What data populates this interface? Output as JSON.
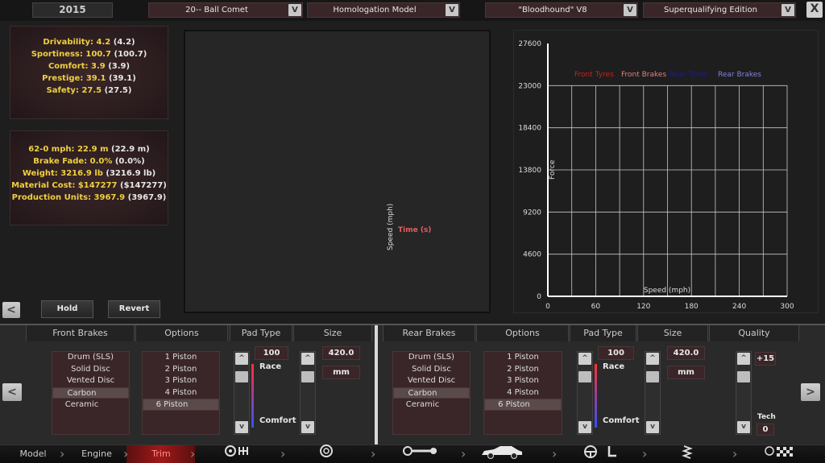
{
  "topbar": {
    "year": "2015",
    "model": "20-- Ball Comet",
    "trim": "Homologation Model",
    "engine": "\"Bloodhound\" V8",
    "variant": "Superqualifying Edition",
    "dropdown_glyph": "V",
    "close_glyph": "X"
  },
  "stats_panel": {
    "rows": [
      {
        "label": "Drivability:",
        "value": "4.2",
        "compare": "(4.2)"
      },
      {
        "label": "Sportiness:",
        "value": "100.7",
        "compare": "(100.7)"
      },
      {
        "label": "Comfort:",
        "value": "3.9",
        "compare": "(3.9)"
      },
      {
        "label": "Prestige:",
        "value": "39.1",
        "compare": "(39.1)"
      },
      {
        "label": "Safety:",
        "value": "27.5",
        "compare": "(27.5)"
      }
    ]
  },
  "specs_panel": {
    "rows": [
      {
        "label": "62-0 mph:",
        "value": "22.9 m",
        "compare": "(22.9 m)"
      },
      {
        "label": "Brake Fade:",
        "value": "0.0%",
        "compare": "(0.0%)"
      },
      {
        "label": "Weight:",
        "value": "3216.9 lb",
        "compare": "(3216.9 lb)"
      },
      {
        "label": "Material Cost:",
        "value": "$147277",
        "compare": "($147277)"
      },
      {
        "label": "Production Units:",
        "value": "3967.9",
        "compare": "(3967.9)"
      }
    ]
  },
  "buttons": {
    "hold": "Hold",
    "revert": "Revert",
    "prev": "<",
    "next": ">"
  },
  "viewport": {
    "axis_x": "Time (s)",
    "axis_y": "Speed (mph)"
  },
  "chart_data": {
    "type": "line",
    "legend": [
      {
        "name": "Front Tyres",
        "color": "#cc2020"
      },
      {
        "name": "Front Brakes",
        "color": "#e08080"
      },
      {
        "name": "Rear Tyres",
        "color": "#1a1aa0"
      },
      {
        "name": "Rear Brakes",
        "color": "#8080e0"
      }
    ],
    "xlabel": "Speed (mph)",
    "ylabel": "Force",
    "xlim": [
      0,
      300
    ],
    "ylim": [
      0,
      27600
    ],
    "xticks": [
      "0",
      "60",
      "120",
      "180",
      "240",
      "300"
    ],
    "yticks": [
      "0",
      "4600",
      "9200",
      "13800",
      "18400",
      "23000",
      "27600"
    ],
    "grid": true,
    "series": []
  },
  "front_brakes": {
    "header": "Front Brakes",
    "options_header": "Options",
    "pad_header": "Pad Type",
    "size_header": "Size",
    "types": [
      "Drum (SLS)",
      "Solid Disc",
      "Vented Disc",
      "Carbon Ceramic"
    ],
    "selected_type": 3,
    "pistons": [
      "1 Piston",
      "2 Piston",
      "3 Piston",
      "4 Piston",
      "6 Piston"
    ],
    "selected_piston": 4,
    "pad_value": "100",
    "pad_high": "Race",
    "pad_low": "Comfort",
    "size_value": "420.0",
    "size_unit": "mm"
  },
  "rear_brakes": {
    "header": "Rear Brakes",
    "options_header": "Options",
    "pad_header": "Pad Type",
    "size_header": "Size",
    "quality_header": "Quality",
    "types": [
      "Drum (SLS)",
      "Solid Disc",
      "Vented Disc",
      "Carbon Ceramic"
    ],
    "selected_type": 3,
    "pistons": [
      "1 Piston",
      "2 Piston",
      "3 Piston",
      "4 Piston",
      "6 Piston"
    ],
    "selected_piston": 4,
    "pad_value": "100",
    "pad_high": "Race",
    "pad_low": "Comfort",
    "size_value": "420.0",
    "size_unit": "mm",
    "quality_value": "+15",
    "tech_label": "Tech",
    "tech_value": "0"
  },
  "scroll": {
    "up": "^",
    "down": "v"
  },
  "nav": {
    "model": "Model",
    "engine": "Engine",
    "trim": "Trim",
    "icons": [
      "gearbox-icon",
      "wheel-icon",
      "chassis-icon",
      "car-body-icon",
      "steering-icon",
      "seat-icon",
      "suspension-icon",
      "finish-flag-icon"
    ]
  }
}
